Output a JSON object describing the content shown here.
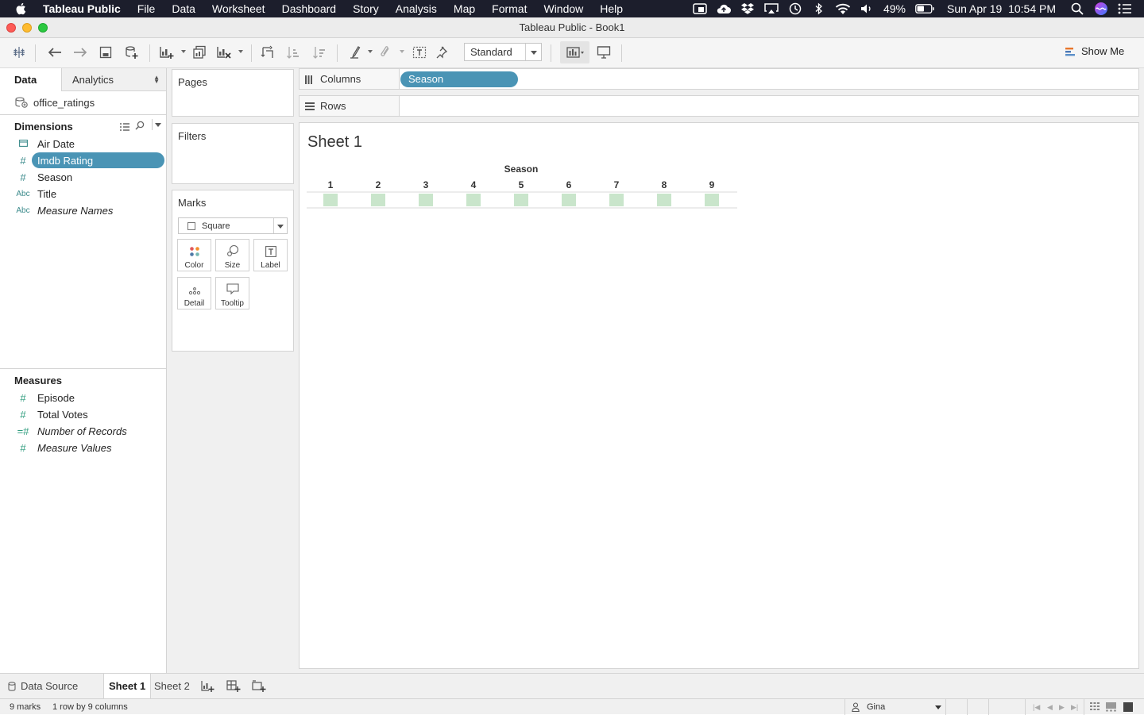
{
  "menubar": {
    "app_name": "Tableau Public",
    "items": [
      "File",
      "Data",
      "Worksheet",
      "Dashboard",
      "Story",
      "Analysis",
      "Map",
      "Format",
      "Window",
      "Help"
    ],
    "battery": "49%",
    "datetime": "Sun Apr 19  10:54 PM"
  },
  "window": {
    "title": "Tableau Public - Book1"
  },
  "toolbar": {
    "fit_select": "Standard",
    "show_me": "Show Me"
  },
  "left_pane": {
    "tabs": {
      "data": "Data",
      "analytics": "Analytics"
    },
    "data_source": "office_ratings",
    "dimensions_header": "Dimensions",
    "dimensions": [
      {
        "type": "date",
        "icon_text": "",
        "label": "Air Date"
      },
      {
        "type": "number",
        "icon_text": "#",
        "label": "Imdb Rating",
        "selected": true
      },
      {
        "type": "number",
        "icon_text": "#",
        "label": "Season"
      },
      {
        "type": "text",
        "icon_text": "Abc",
        "label": "Title"
      },
      {
        "type": "text",
        "icon_text": "Abc",
        "label": "Measure Names",
        "italic": true
      }
    ],
    "measures_header": "Measures",
    "measures": [
      {
        "icon_text": "#",
        "label": "Episode"
      },
      {
        "icon_text": "#",
        "label": "Total Votes"
      },
      {
        "icon_text": "=#",
        "label": "Number of Records",
        "italic": true
      },
      {
        "icon_text": "#",
        "label": "Measure Values",
        "italic": true
      }
    ]
  },
  "cards": {
    "pages": "Pages",
    "filters": "Filters",
    "marks": "Marks",
    "mark_type": "Square",
    "mark_buttons": {
      "color": "Color",
      "size": "Size",
      "label": "Label",
      "detail": "Detail",
      "tooltip": "Tooltip"
    }
  },
  "shelves": {
    "columns_label": "Columns",
    "rows_label": "Rows",
    "columns_pill": "Season"
  },
  "sheet": {
    "title": "Sheet 1",
    "header": "Season"
  },
  "chart_data": {
    "type": "table",
    "xlabel": "Season",
    "categories": [
      "1",
      "2",
      "3",
      "4",
      "5",
      "6",
      "7",
      "8",
      "9"
    ],
    "mark": "square",
    "mark_color": "#c9e5cb"
  },
  "bottom": {
    "data_source_tab": "Data Source",
    "sheet_tabs": [
      "Sheet 1",
      "Sheet 2"
    ]
  },
  "status": {
    "marks": "9 marks",
    "dims": "1 row by 9 columns",
    "user": "Gina"
  },
  "colors": {
    "accent_pill": "#4a94b5",
    "menubar": "#1c1e2c"
  }
}
